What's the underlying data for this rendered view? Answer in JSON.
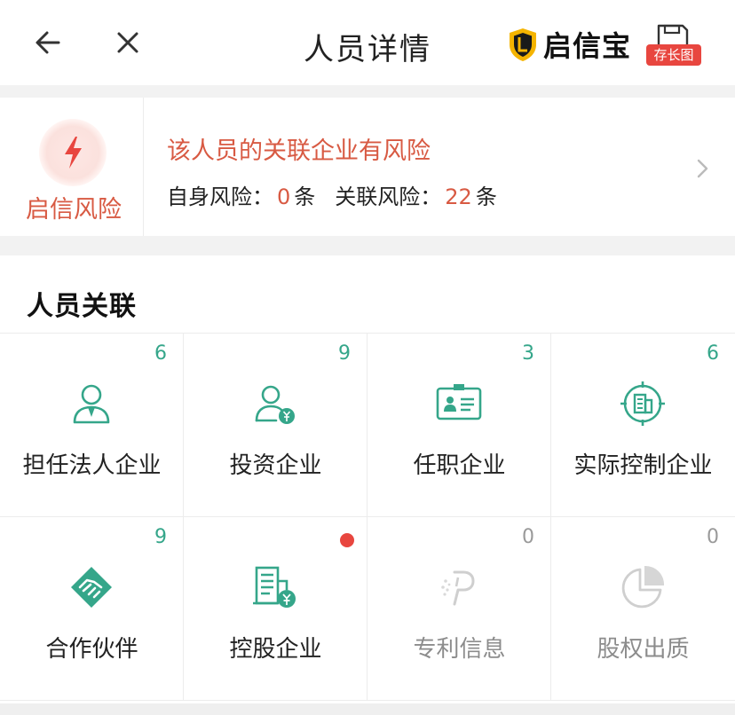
{
  "header": {
    "title": "人员详情",
    "brand": "启信宝",
    "save_label": "存长图"
  },
  "risk": {
    "badge_label": "启信风险",
    "headline": "该人员的关联企业有风险",
    "self_label": "自身风险：",
    "self_count": "0",
    "related_label": "关联风险：",
    "related_count": "22",
    "unit": "条"
  },
  "relation": {
    "title": "人员关联",
    "items": [
      {
        "label": "担任法人企业",
        "count": "6",
        "icon": "person-icon"
      },
      {
        "label": "投资企业",
        "count": "9",
        "icon": "investor-icon"
      },
      {
        "label": "任职企业",
        "count": "3",
        "icon": "id-card-icon"
      },
      {
        "label": "实际控制企业",
        "count": "6",
        "icon": "target-building-icon"
      },
      {
        "label": "合作伙伴",
        "count": "9",
        "icon": "handshake-icon"
      },
      {
        "label": "控股企业",
        "count": "",
        "icon": "holding-building-icon"
      },
      {
        "label": "专利信息",
        "count": "0",
        "icon": "patent-icon"
      },
      {
        "label": "股权出质",
        "count": "0",
        "icon": "pie-chart-icon"
      }
    ]
  },
  "colors": {
    "accent_green": "#35a68a",
    "risk_red": "#d85a43",
    "badge_red": "#e8463f",
    "disabled_gray": "#bdbdbd"
  }
}
